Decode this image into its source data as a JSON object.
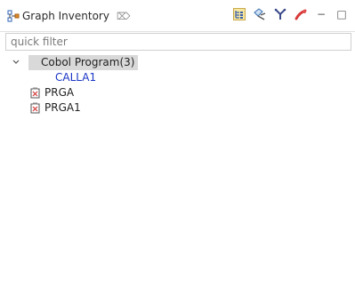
{
  "view": {
    "title": "Graph Inventory",
    "close_glyph": "⌦",
    "toolbar": {
      "icons": [
        "tree-layout-icon",
        "hide-icon",
        "filter-icon",
        "pin-icon",
        "minimize-icon",
        "maximize-icon"
      ],
      "minimize_glyph": "−",
      "maximize_glyph": "□"
    }
  },
  "filter": {
    "placeholder": "quick filter",
    "value": ""
  },
  "tree": {
    "root": {
      "label": "Cobol Program(3)",
      "expanded": true,
      "children": [
        {
          "label": "CALLA1",
          "icon": "none",
          "color": "#1a35c7"
        },
        {
          "label": "PRGA",
          "icon": "program-file-icon"
        },
        {
          "label": "PRGA1",
          "icon": "program-file-icon"
        }
      ]
    }
  },
  "colors": {
    "selected_row": "#d9d9d9",
    "link_text": "#1a35c7",
    "file_icon_red": "#d23a3a"
  }
}
